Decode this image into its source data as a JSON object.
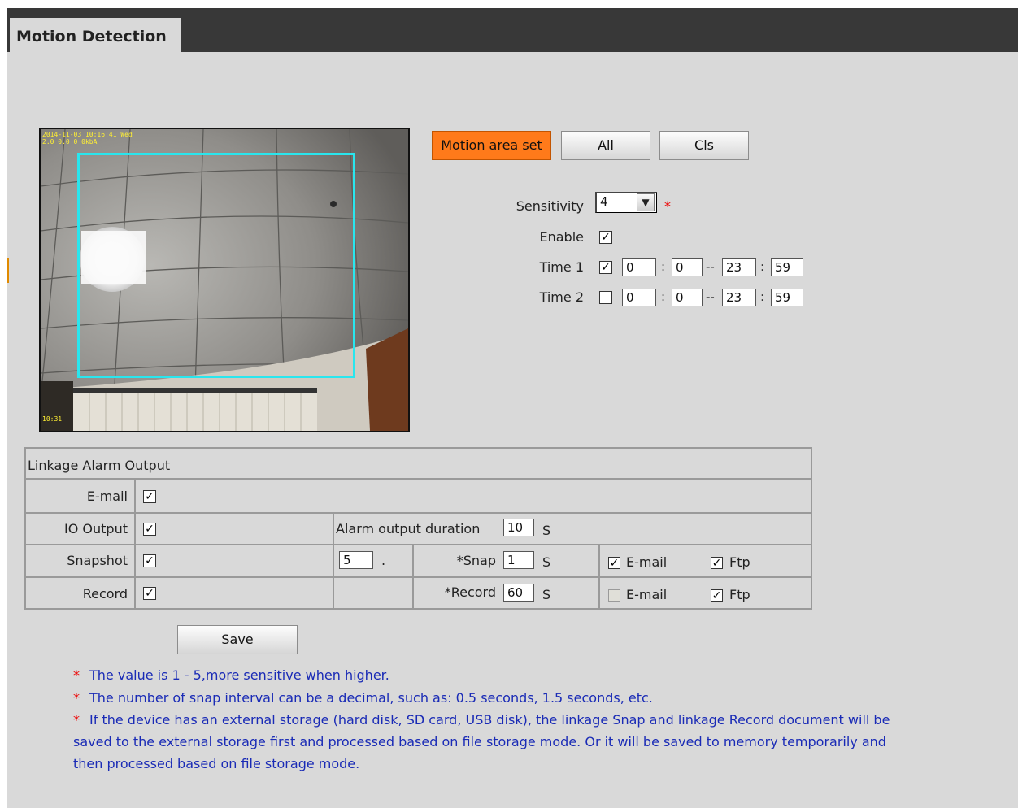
{
  "tab": {
    "title": "Motion Detection"
  },
  "preview": {
    "osd_top_line1": "2014-11-03 10:16:41 Wed",
    "osd_top_line2": "2.0 0.0 0 0kbA",
    "osd_bottom": "10:31"
  },
  "buttons": {
    "motion_area_set": "Motion area set",
    "all": "All",
    "cls": "Cls",
    "save": "Save"
  },
  "settings": {
    "sensitivity_label": "Sensitivity",
    "sensitivity_value": "4",
    "enable_label": "Enable",
    "enable_checked": true,
    "time1": {
      "label": "Time 1",
      "checked": true,
      "start_h": "0",
      "start_m": "0",
      "end_h": "23",
      "end_m": "59"
    },
    "time2": {
      "label": "Time 2",
      "checked": false,
      "start_h": "0",
      "start_m": "0",
      "end_h": "23",
      "end_m": "59"
    }
  },
  "linkage": {
    "header": "Linkage Alarm Output",
    "email_label": "E-mail",
    "io_label": "IO Output",
    "io_duration_label": "Alarm output duration",
    "io_duration_value": "10",
    "io_duration_unit": "S",
    "snapshot_label": "Snapshot",
    "snapshot_count": "5",
    "snapshot_dot": ".",
    "snap_label": "*Snap",
    "snap_value": "1",
    "snap_unit": "S",
    "snap_email_label": "E-mail",
    "snap_ftp_label": "Ftp",
    "record_label": "Record",
    "record_field_label": "*Record",
    "record_value": "60",
    "record_unit": "S",
    "record_email_label": "E-mail",
    "record_ftp_label": "Ftp"
  },
  "notes": [
    "The value is 1 - 5,more sensitive when higher.",
    "The number of snap interval can be a decimal, such as: 0.5 seconds, 1.5 seconds, etc.",
    "If the device has an external storage (hard disk, SD card, USB disk), the linkage Snap and linkage Record document will be",
    "saved to the external storage first and processed based on file storage mode. Or it will be saved to memory temporarily and",
    "then processed based on file storage mode."
  ],
  "note_marker": "*",
  "required_marker": "*",
  "colors": {
    "tab_bar": "#383838",
    "panel": "#d9d9d9",
    "accent_button": "#ff7a1a",
    "motion_rect": "#29e6ee",
    "note_text": "#1a2bb6",
    "required": "#e00000"
  }
}
